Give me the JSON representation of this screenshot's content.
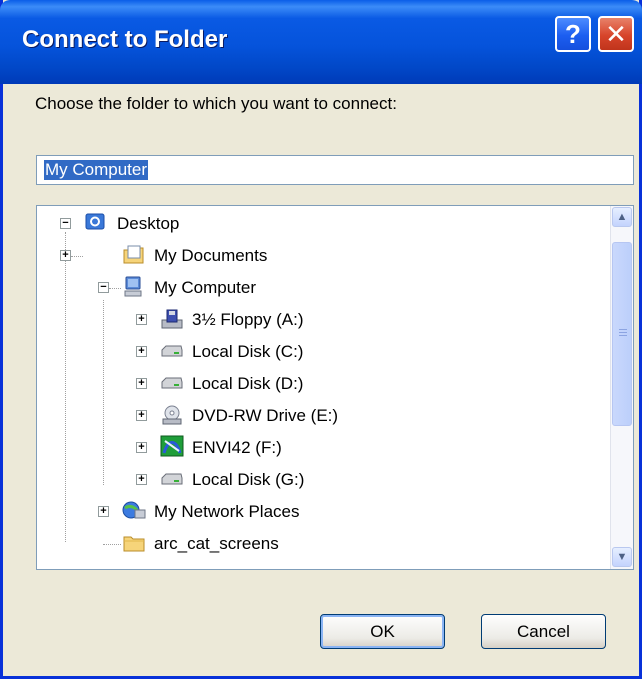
{
  "window": {
    "title": "Connect to Folder",
    "help_glyph": "?",
    "close_glyph": "✕"
  },
  "prompt": "Choose the folder to which you want to connect:",
  "path_value": "My Computer",
  "tree": [
    {
      "label": "Desktop",
      "icon": "desktop-icon",
      "expander": "−"
    },
    {
      "label": "My Documents",
      "icon": "documents-folder-icon",
      "expander": "+"
    },
    {
      "label": "My Computer",
      "icon": "computer-icon",
      "expander": "−"
    },
    {
      "label": "3½ Floppy (A:)",
      "icon": "floppy-drive-icon",
      "expander": "+"
    },
    {
      "label": "Local Disk (C:)",
      "icon": "hard-disk-icon",
      "expander": "+"
    },
    {
      "label": "Local Disk (D:)",
      "icon": "hard-disk-icon",
      "expander": "+"
    },
    {
      "label": "DVD-RW Drive (E:)",
      "icon": "dvd-drive-icon",
      "expander": "+"
    },
    {
      "label": "ENVI42 (F:)",
      "icon": "cd-volume-icon",
      "expander": "+"
    },
    {
      "label": "Local Disk (G:)",
      "icon": "hard-disk-icon",
      "expander": "+"
    },
    {
      "label": "My Network Places",
      "icon": "network-places-icon",
      "expander": "+"
    },
    {
      "label": "arc_cat_screens",
      "icon": "folder-icon",
      "expander": ""
    }
  ],
  "buttons": {
    "ok": "OK",
    "cancel": "Cancel"
  },
  "scrollbar": {
    "up_glyph": "▲",
    "down_glyph": "▼"
  }
}
